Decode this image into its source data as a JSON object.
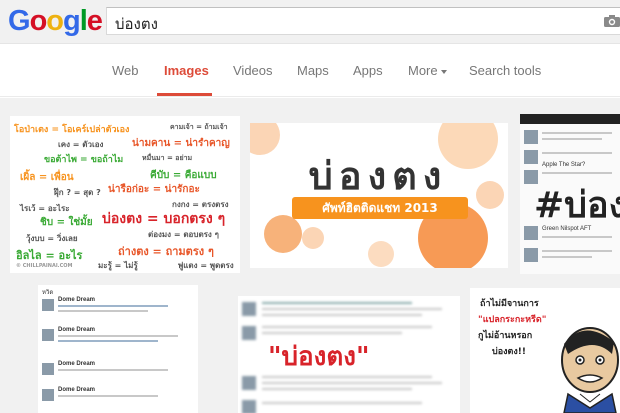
{
  "header": {
    "logo": [
      "G",
      "o",
      "o",
      "g",
      "l",
      "e"
    ],
    "logo_colors": [
      "#3369e8",
      "#d50f25",
      "#eeb211",
      "#3369e8",
      "#009925",
      "#d50f25"
    ],
    "search_query": "บ่องตง"
  },
  "tabs": [
    {
      "label": "Web"
    },
    {
      "label": "Images",
      "active": true
    },
    {
      "label": "Videos"
    },
    {
      "label": "Maps"
    },
    {
      "label": "Apps"
    },
    {
      "label": "More"
    },
    {
      "label": "Search tools"
    }
  ],
  "results": {
    "thumb1": {
      "words": [
        "โอป่าเตง = โอเคร์เปล่าตัวเอง",
        "คามเจ้า = ถ้ามเจ้า",
        "เคง = ตัวเอง",
        "น่ามคาน = น่ารำคาญ",
        "ขอต้าไพ = ขอถ้าไม",
        "หมื่นมา = อย่าม",
        "เผิ้ล = เพื่อน",
        "คีบับ = คือแบบ",
        "ฝุ๊ก ? = สุด ?",
        "น่ารือก่อะ = น่ารักอะ",
        "ไรเว้ = อะไระ",
        "กงกง = ตรงตรง",
        "ชิบ = ใช่มั้ย",
        "บ่องตง = บอกตรง ๆ",
        "วุ้งบบ = วิ่งเลย",
        "ต่องมง = ตอบตรง ๆ",
        "อิลไล = อะไร",
        "ถ่างตง = ถามตรง ๆ",
        "มะรู้ = ไม่รู้",
        "พู่แตง = พูดตรง",
        "© CHILLPAINAI.COM"
      ]
    },
    "thumb2": {
      "title": "บ่องตง",
      "subtitle": "ศัพท์ฮิตติดแชท 2013"
    },
    "thumb3": {
      "overlay": "#บ่อง",
      "names": [
        "Apple The Star?",
        "Green Nilspot AFT"
      ]
    },
    "thumb4": {
      "header": "หวิด",
      "names": [
        "Dome Dream",
        "Dome Dream",
        "Dome Dream",
        "Dome Dream"
      ]
    },
    "thumb5": {
      "overlay": "\"บ่องตง\""
    },
    "thumb6": {
      "lines": [
        "ถ้าไม่มีจานการ",
        "\"แปลกระกะหรีด\"",
        "กูไม่อ้านหรอก",
        "บ่องตง!!"
      ]
    }
  },
  "colors": {
    "accent_red": "#dd4b39",
    "tab_gray": "#777777",
    "header_bg": "#f1f1f1",
    "orange": "#f7931e"
  },
  "icons": [
    "camera-icon",
    "caret-down-icon"
  ]
}
